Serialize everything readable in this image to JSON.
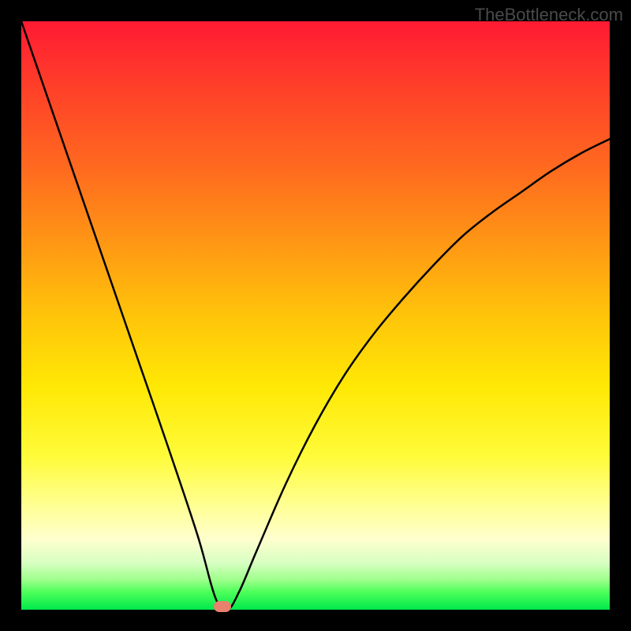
{
  "attribution": "TheBottleneck.com",
  "chart_data": {
    "type": "line",
    "title": "",
    "xlabel": "",
    "ylabel": "",
    "xlim": [
      0,
      100
    ],
    "ylim": [
      0,
      100
    ],
    "grid": false,
    "series": [
      {
        "name": "bottleneck-curve",
        "x": [
          0,
          5,
          10,
          15,
          20,
          25,
          30,
          33,
          35,
          37,
          40,
          45,
          50,
          55,
          60,
          65,
          70,
          75,
          80,
          85,
          90,
          95,
          100
        ],
        "values": [
          100,
          85.5,
          71,
          56.5,
          42,
          27.5,
          12.5,
          2,
          0,
          3,
          10,
          21.5,
          31.5,
          40,
          47,
          53,
          58.5,
          63.5,
          67.5,
          71,
          74.5,
          77.5,
          80
        ]
      }
    ],
    "marker": {
      "x": 34.2,
      "y": 0
    },
    "annotations": []
  },
  "colors": {
    "curve": "#000000",
    "marker": "#e8816e",
    "background_top": "#ff1a33",
    "background_bottom": "#00e84c",
    "frame": "#000000"
  }
}
